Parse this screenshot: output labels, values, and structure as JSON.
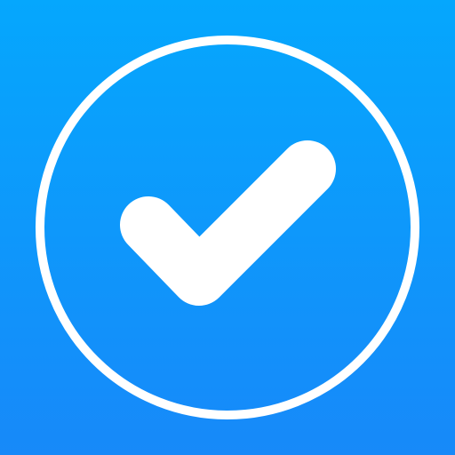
{
  "icon": {
    "name": "checkmark-circle-icon",
    "colors": {
      "background_top": "#05a7fd",
      "background_bottom": "#1789f9",
      "foreground": "#ffffff"
    }
  }
}
